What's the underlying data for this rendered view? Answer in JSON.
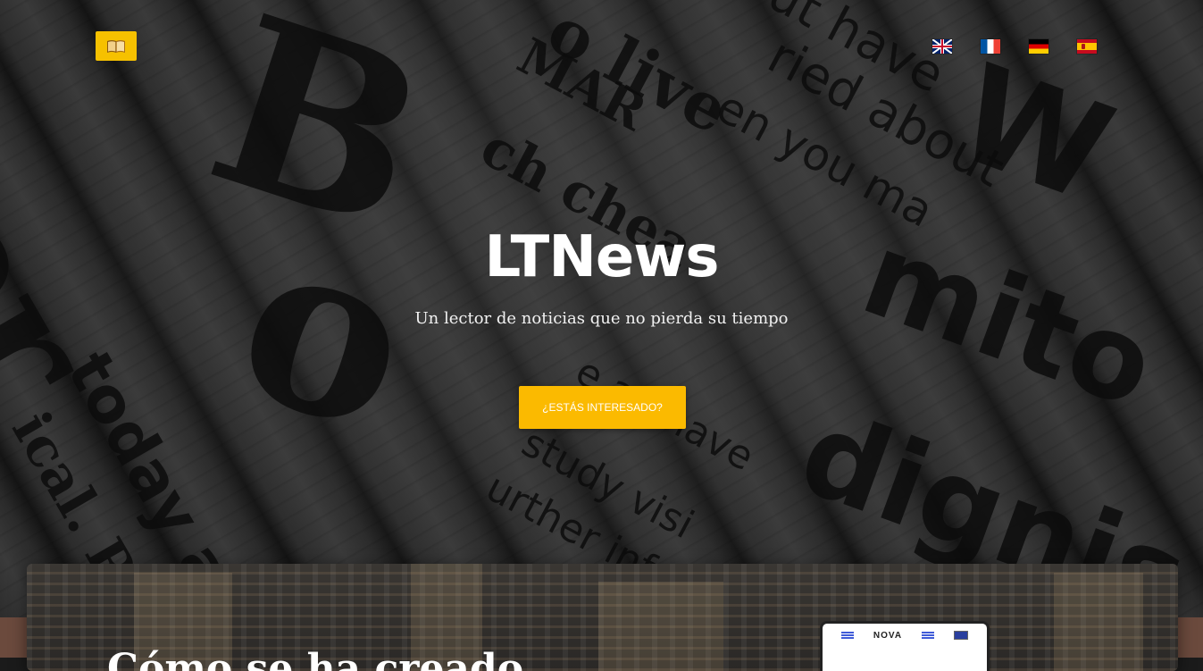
{
  "header": {
    "logo_icon": "book-icon",
    "languages": [
      {
        "code": "en",
        "icon": "flag-uk-icon"
      },
      {
        "code": "fr",
        "icon": "flag-fr-icon"
      },
      {
        "code": "de",
        "icon": "flag-de-icon"
      },
      {
        "code": "es",
        "icon": "flag-es-icon"
      }
    ]
  },
  "hero": {
    "title": "LTNews",
    "subtitle": "Un lector de noticias que no pierda su tiempo",
    "cta_label": "¿ESTÁS INTERESADO?",
    "background_words": [
      "o live",
      "ried about",
      "ut have",
      "MAR",
      "en you ma",
      "ch chea",
      "today as",
      "ical. R",
      "study visi",
      "urther inf",
      "e an have",
      "W",
      "mito",
      "dignis",
      "B",
      "pr",
      "o"
    ]
  },
  "section": {
    "heading": "Cómo se ha creado",
    "mockup": {
      "brand": "NOVA"
    }
  },
  "colors": {
    "accent": "#fbba00",
    "logo_bg": "#f6c100",
    "hero_text": "#ffffff",
    "band": "#6b4a3d"
  }
}
